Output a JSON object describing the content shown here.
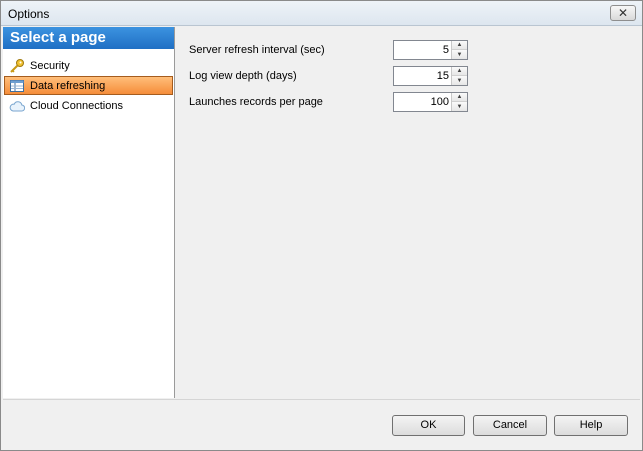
{
  "window": {
    "title": "Options",
    "close_glyph": "✕"
  },
  "left_panel": {
    "header": "Select a page",
    "items": [
      {
        "label": "Security",
        "icon": "key-icon",
        "selected": false
      },
      {
        "label": "Data refreshing",
        "icon": "table-icon",
        "selected": true
      },
      {
        "label": "Cloud Connections",
        "icon": "cloud-icon",
        "selected": false
      }
    ]
  },
  "settings": [
    {
      "label": "Server refresh interval (sec)",
      "value": "5"
    },
    {
      "label": "Log view depth (days)",
      "value": "15"
    },
    {
      "label": "Launches records per page",
      "value": "100"
    }
  ],
  "buttons": {
    "ok": "OK",
    "cancel": "Cancel",
    "help": "Help"
  },
  "colors": {
    "header_blue": "#2b7fd3",
    "selected_orange": "#f7a25c"
  }
}
